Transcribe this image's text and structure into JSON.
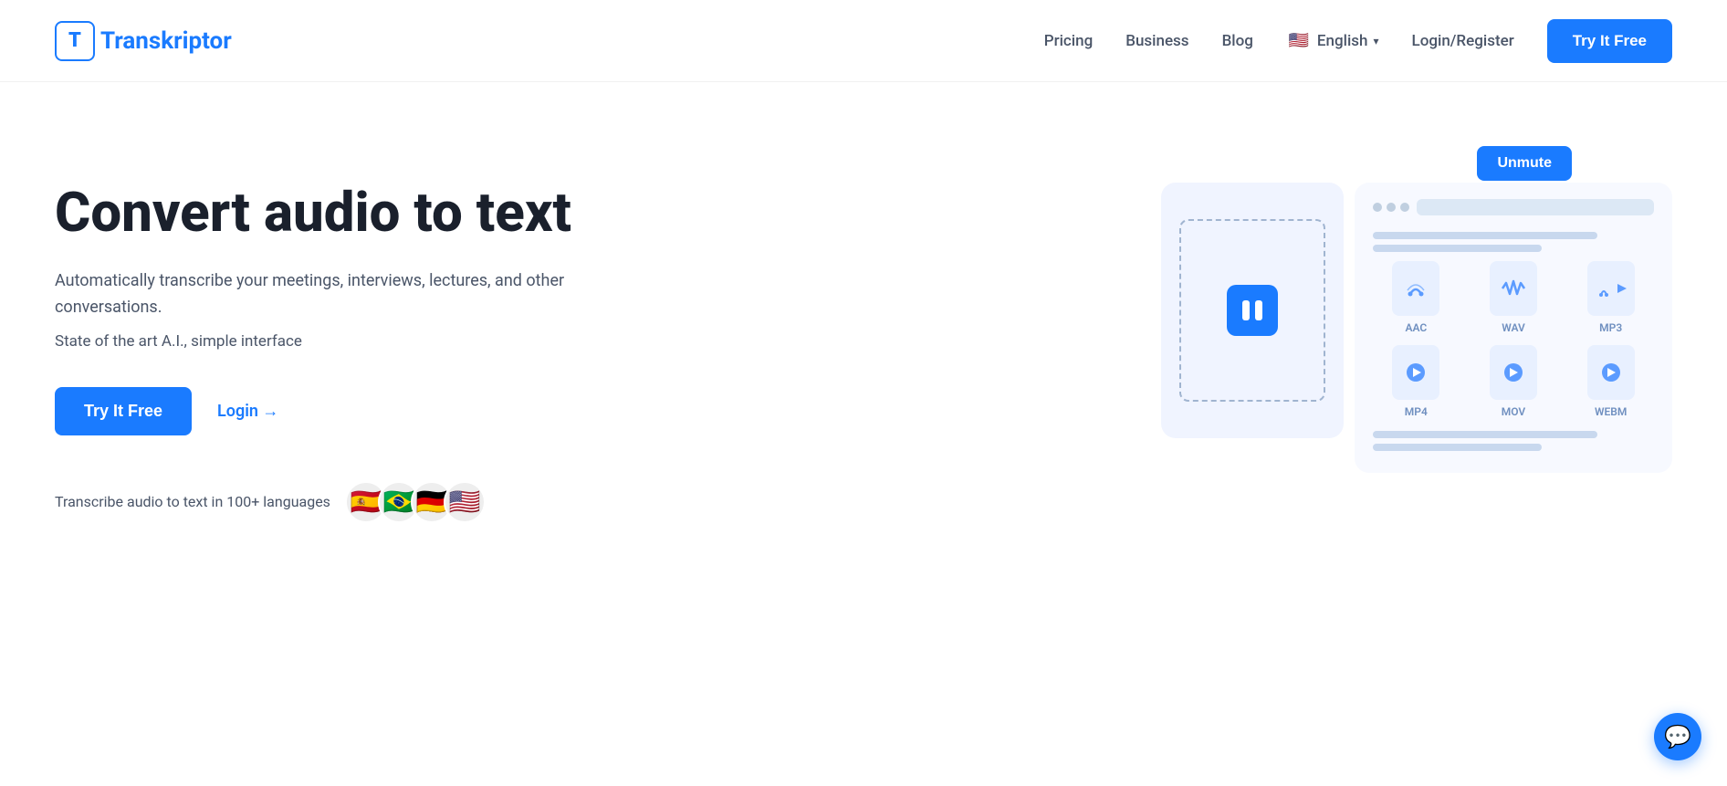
{
  "logo": {
    "icon_letter": "T",
    "name": "Transkriptor",
    "url": "#"
  },
  "nav": {
    "pricing": "Pricing",
    "business": "Business",
    "blog": "Blog",
    "language": "English",
    "login_register": "Login/Register",
    "try_btn": "Try It Free"
  },
  "hero": {
    "title": "Convert audio to text",
    "description": "Automatically transcribe your meetings, interviews, lectures, and other conversations.",
    "subtext": "State of the art A.I., simple interface",
    "try_free_btn": "Try It Free",
    "login_btn": "Login →",
    "languages_text": "Transcribe audio to text in 100+ languages",
    "unmute_btn": "Unmute"
  },
  "file_types": [
    {
      "label": "AAC",
      "type": "audio"
    },
    {
      "label": "WAV",
      "type": "audio"
    },
    {
      "label": "MP3",
      "type": "audio"
    },
    {
      "label": "MP4",
      "type": "video"
    },
    {
      "label": "MOV",
      "type": "video"
    },
    {
      "label": "WEBM",
      "type": "video"
    }
  ],
  "flags": [
    "🇪🇸",
    "🇧🇷",
    "🇩🇪",
    "🇺🇸"
  ],
  "colors": {
    "primary": "#1a7bff",
    "text_dark": "#1a202c",
    "text_mid": "#4a5568",
    "bg_light": "#f7f9ff"
  }
}
